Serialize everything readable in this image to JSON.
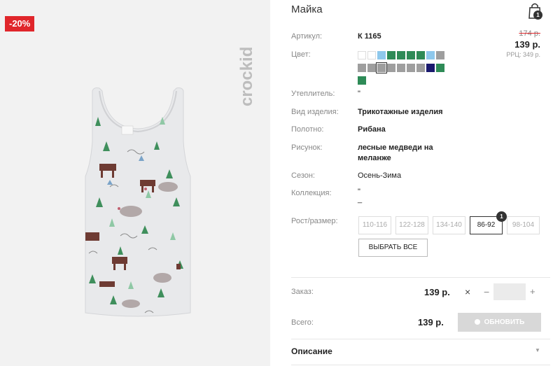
{
  "product": {
    "title": "Майка",
    "discount": "-20%",
    "brand": "crockid"
  },
  "cart": {
    "count": "1",
    "icon": "shopping-bag-icon"
  },
  "prices": {
    "old": "174 р.",
    "current": "139 р.",
    "rrp": "РРЦ: 349 р."
  },
  "attributes": {
    "article": {
      "label": "Артикул:",
      "value": "К 1165"
    },
    "color": {
      "label": "Цвет:"
    },
    "insulation": {
      "label": "Утеплитель:",
      "value": "\""
    },
    "type": {
      "label": "Вид изделия:",
      "value": "Трикотажные изделия"
    },
    "fabric": {
      "label": "Полотно:",
      "value": "Рибана"
    },
    "pattern": {
      "label": "Рисунок:",
      "value_line1": "лесные медведи на",
      "value_line2": "меланже"
    },
    "season": {
      "label": "Сезон:",
      "value": "Осень-Зима"
    },
    "collection": {
      "label": "Коллекция:",
      "value_line1": "\"",
      "value_line2": "_"
    }
  },
  "colors": [
    "#ffffff",
    "#ffffff",
    "#8ec8ec",
    "#2e8b57",
    "#2e8b57",
    "#2e8b57",
    "#2e8b57",
    "#8ec8ec",
    "#9e9e9e",
    "#9e9e9e",
    "#9e9e9e",
    "#9e9e9e",
    "#9e9e9e",
    "#9e9e9e",
    "#9e9e9e",
    "#9e9e9e",
    "#1a1a6e",
    "#2e8b57",
    "#2e8b57"
  ],
  "sizes": {
    "label": "Рост/размер:",
    "options": [
      "110-116",
      "122-128",
      "134-140",
      "86-92",
      "98-104"
    ],
    "selected_badge": "1",
    "select_all": "ВЫБРАТЬ ВСЕ"
  },
  "order": {
    "label": "Заказ:",
    "price": "139 р.",
    "times": "×",
    "minus": "−",
    "plus": "+"
  },
  "total": {
    "label": "Всего:",
    "price": "139 р.",
    "update_button": "ОБНОВИТЬ"
  },
  "description": {
    "label": "Описание"
  }
}
